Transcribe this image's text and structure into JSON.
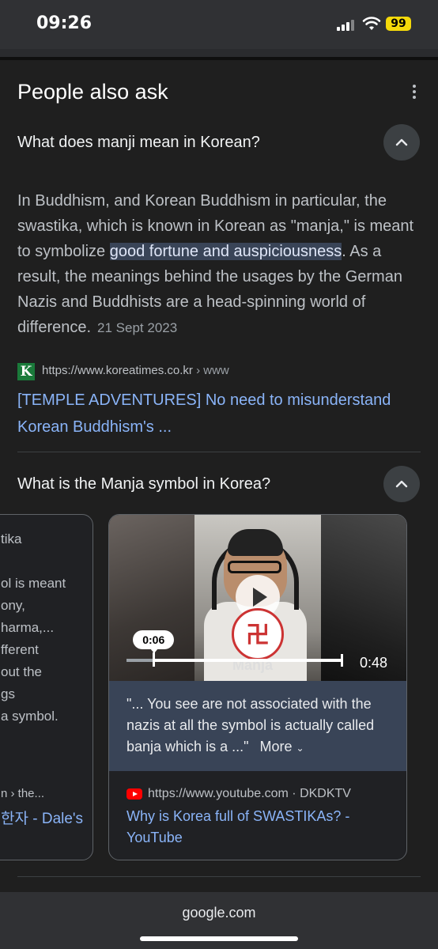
{
  "status_bar": {
    "time": "09:26",
    "battery": "99"
  },
  "paa": {
    "title": "People also ask"
  },
  "q1": {
    "question": "What does manji mean in Korean?",
    "answer_part1": "In Buddhism, and Korean Buddhism in particular, the swastika, which is known in Korean as \"manja,\" is meant to symbolize ",
    "answer_highlight": "good fortune and auspiciousness",
    "answer_part2": ". As a result, the meanings behind the usages by the German Nazis and Buddhists are a head-spinning world of difference.",
    "date": "21 Sept 2023",
    "source_logo": "K",
    "source_url": "https://www.koreatimes.co.kr",
    "source_crumb": " › www",
    "link": "[TEMPLE ADVENTURES] No need to misunderstand Korean Buddhism's ..."
  },
  "q2": {
    "question": "What is the Manja symbol in Korea?",
    "left_card": {
      "lines": [
        "tika",
        "ol is meant",
        "ony,",
        "harma,...",
        "fferent",
        "out the",
        "gs",
        "a symbol."
      ],
      "source": "n › the...",
      "link": "한자 - Dale's"
    },
    "video_card": {
      "scrub_time": "0:06",
      "progress": 0.125,
      "duration": "0:48",
      "overlay_text": "Manja",
      "transcript": "\"... You see are not associated with the nazis at all the symbol is actually called banja which is a ...\"",
      "more_label": "More",
      "source_url": "https://www.youtube.com · DKDKTV",
      "link": "Why is Korea full of SWASTIKAs? - YouTube"
    }
  },
  "bottom_bar": {
    "url": "google.com"
  }
}
